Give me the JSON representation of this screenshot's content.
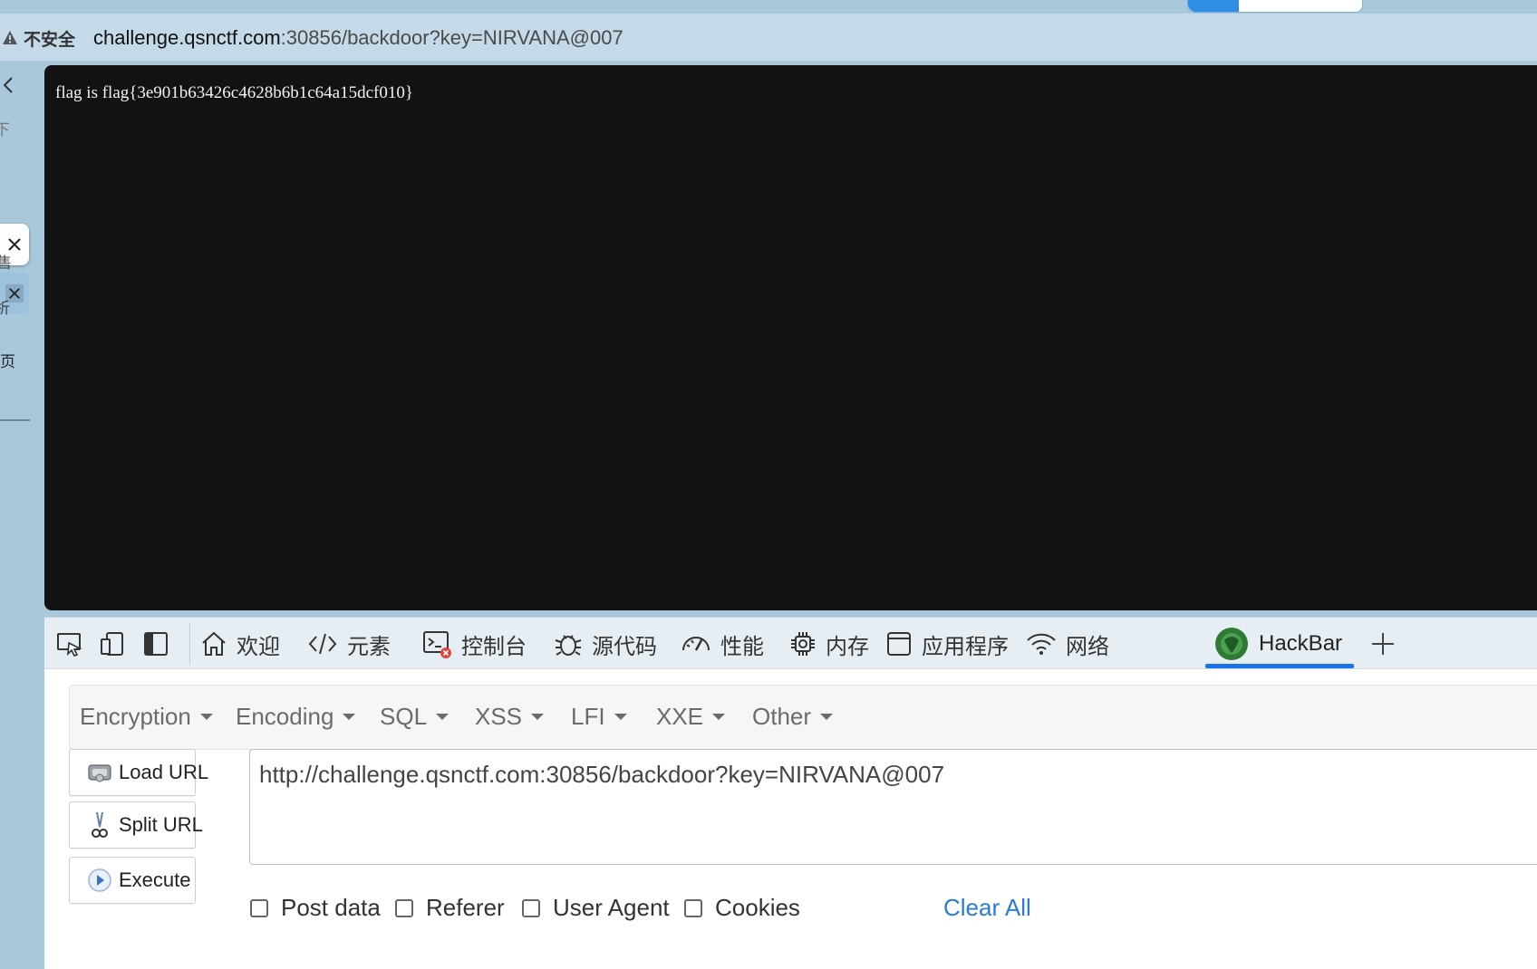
{
  "browser": {
    "security_label": "不安全",
    "url_host": "challenge.qsnctf.com",
    "url_rest": ":30856/backdoor?key=NIRVANA@007"
  },
  "side_panel": {
    "items": [
      "下",
      "售",
      "析",
      "页"
    ]
  },
  "page": {
    "content": "flag is flag{3e901b63426c4628b6b1c64a15dcf010}"
  },
  "devtools": {
    "tabs": {
      "welcome": "欢迎",
      "elements": "元素",
      "console": "控制台",
      "sources": "源代码",
      "performance": "性能",
      "memory": "内存",
      "application": "应用程序",
      "network": "网络",
      "hackbar": "HackBar"
    }
  },
  "hackbar": {
    "menu": {
      "encryption": "Encryption",
      "encoding": "Encoding",
      "sql": "SQL",
      "xss": "XSS",
      "lfi": "LFI",
      "xxe": "XXE",
      "other": "Other"
    },
    "buttons": {
      "load_url": "Load URL",
      "split_url": "Split URL",
      "execute": "Execute"
    },
    "url_value": "http://challenge.qsnctf.com:30856/backdoor?key=NIRVANA@007",
    "options": {
      "post_data": "Post data",
      "referer": "Referer",
      "user_agent": "User Agent",
      "cookies": "Cookies",
      "clear_all": "Clear All"
    }
  },
  "colors": {
    "accent": "#1a73e8",
    "link": "#2a7bd4",
    "page_bg": "#121212",
    "frame": "#a9c8dc"
  }
}
